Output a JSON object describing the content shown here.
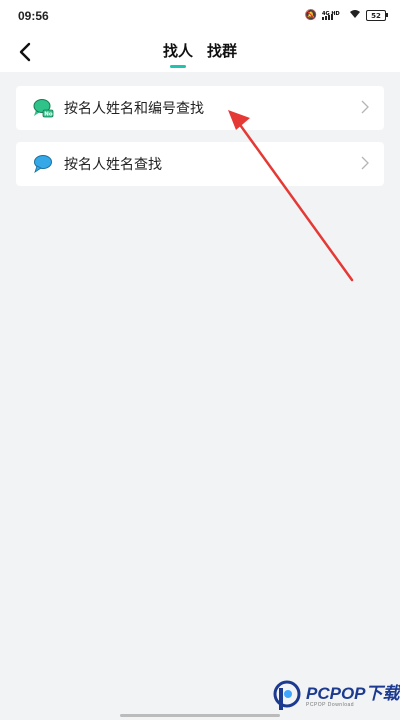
{
  "status_bar": {
    "time": "09:56",
    "network_label": "4G HD",
    "battery_level": "52",
    "icons": [
      "mute-icon",
      "signal-icon",
      "wifi-icon",
      "battery-icon"
    ]
  },
  "nav": {
    "tabs": [
      {
        "label": "找人",
        "active": true
      },
      {
        "label": "找群",
        "active": false
      }
    ],
    "accent_color": "#20c2b0"
  },
  "options": [
    {
      "label": "按名人姓名和编号查找",
      "icon": "chat-bubble-number-icon",
      "icon_color": "#2fc38a"
    },
    {
      "label": "按名人姓名查找",
      "icon": "chat-bubble-search-icon",
      "icon_color": "#35a8e8"
    }
  ],
  "watermark": {
    "text": "PCPOP下载",
    "subtext": "PCPOP Download"
  }
}
